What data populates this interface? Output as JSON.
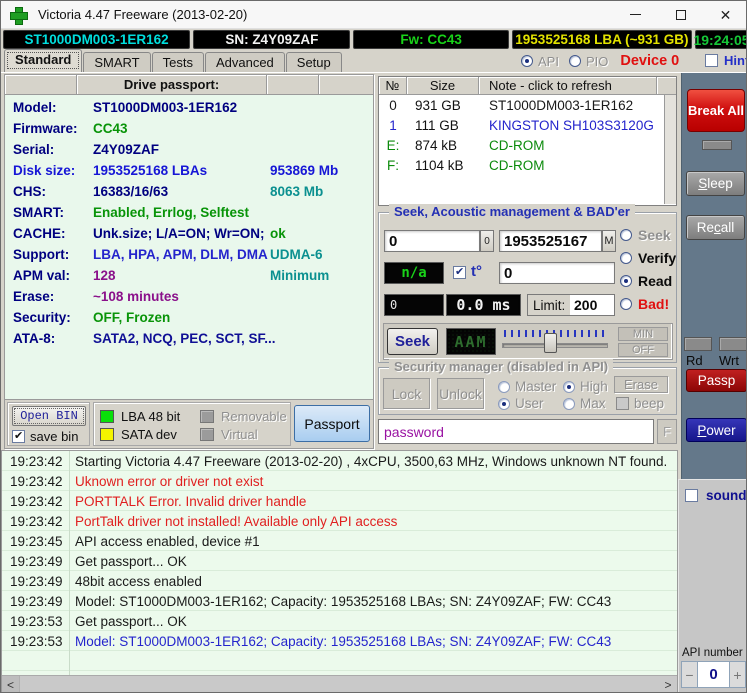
{
  "window": {
    "title": "Victoria 4.47  Freeware (2013-02-20)",
    "icons": {
      "app": "green-cross",
      "minimize": "minimize-line",
      "maximize": "maximize-square",
      "close": "✕",
      "scroll_left": "<",
      "scroll_right": ">",
      "spinner_minus": "−",
      "spinner_plus": "+"
    }
  },
  "info_bar": {
    "model": "ST1000DM003-1ER162",
    "serial": "SN: Z4Y09ZAF",
    "firmware": "Fw: CC43",
    "capacity": "1953525168 LBA (~931 GB)",
    "clock": "19:24:05",
    "colors": {
      "model": "#00dede",
      "serial": "#f2f2f2",
      "firmware": "#19d219",
      "capacity": "#e3e300",
      "clock": "#16c838"
    }
  },
  "tab_bar": {
    "tabs": [
      {
        "label": "Standard",
        "active": true
      },
      {
        "label": "SMART",
        "active": false
      },
      {
        "label": "Tests",
        "active": false
      },
      {
        "label": "Advanced",
        "active": false
      },
      {
        "label": "Setup",
        "active": false
      }
    ],
    "api_label": "API",
    "pio_label": "PIO",
    "device_label": "Device 0",
    "device_color": "#e01010",
    "hints_label": "Hints"
  },
  "passport": {
    "header": "Drive passport:",
    "rows": [
      {
        "label": "Model:",
        "value": "ST1000DM003-1ER162",
        "extra": "",
        "label_color": "#000080",
        "value_color": "#000080",
        "extra_color": "#000080"
      },
      {
        "label": "Firmware:",
        "value": "CC43",
        "extra": "",
        "label_color": "#000080",
        "value_color": "#089408",
        "extra_color": "#000080"
      },
      {
        "label": "Serial:",
        "value": "Z4Y09ZAF",
        "extra": "",
        "label_color": "#000080",
        "value_color": "#000080",
        "extra_color": "#000080"
      },
      {
        "label": "Disk size:",
        "value": "1953525168 LBAs",
        "extra": "953869 Mb",
        "label_color": "#1616d6",
        "value_color": "#1616d6",
        "extra_color": "#1616d6"
      },
      {
        "label": "CHS:",
        "value": "16383/16/63",
        "extra": "8063 Mb",
        "label_color": "#000080",
        "value_color": "#000080",
        "extra_color": "#0b9090"
      },
      {
        "label": "SMART:",
        "value": "Enabled, Errlog, Selftest",
        "extra": "",
        "label_color": "#000080",
        "value_color": "#089408",
        "extra_color": "#000080"
      },
      {
        "label": "CACHE:",
        "value": "Unk.size; L/A=ON; Wr=ON;",
        "extra": "ok",
        "label_color": "#000080",
        "value_color": "#000080",
        "extra_color": "#089408"
      },
      {
        "label": "Support:",
        "value": "LBA, HPA, APM, DLM, DMA",
        "extra": "UDMA-6",
        "label_color": "#000080",
        "value_color": "#2424cc",
        "extra_color": "#0b9090"
      },
      {
        "label": "APM val:",
        "value": "128",
        "extra": "Minimum",
        "label_color": "#000080",
        "value_color": "#8a108a",
        "extra_color": "#0b9090"
      },
      {
        "label": "Erase:",
        "value": "~108 minutes",
        "extra": "",
        "label_color": "#000080",
        "value_color": "#8a108a",
        "extra_color": "#000080"
      },
      {
        "label": "Security:",
        "value": "OFF, Frozen",
        "extra": "",
        "label_color": "#000080",
        "value_color": "#089408",
        "extra_color": "#000080"
      },
      {
        "label": "ATA-8:",
        "value": "SATA2, NCQ, PEC, SCT, SF...",
        "extra": "",
        "label_color": "#000080",
        "value_color": "#101095",
        "extra_color": "#000080"
      }
    ],
    "open_bin_button": "Open BIN",
    "save_bin_label": "save bin",
    "legend": [
      {
        "swatch": "#0ae00a",
        "label": "LBA 48 bit",
        "disabled": false
      },
      {
        "swatch": "#9b9b9b",
        "label": "Removable",
        "disabled": true
      },
      {
        "swatch": "#f4f400",
        "label": "SATA dev",
        "disabled": false
      },
      {
        "swatch": "#9b9b9b",
        "label": "Virtual",
        "disabled": true
      }
    ],
    "passport_button": "Passport"
  },
  "drive_table": {
    "headers": {
      "num": "№",
      "size": "Size",
      "note": "Note - click to refresh"
    },
    "rows": [
      {
        "num": "0",
        "size": "931 GB",
        "note": "ST1000DM003-1ER162",
        "color": "#1a1a1a"
      },
      {
        "num": "1",
        "size": "111 GB",
        "note": "KINGSTON SH103S3120G",
        "color": "#2424cc"
      },
      {
        "num": "E:",
        "size": "874 kB",
        "note": "CD-ROM",
        "color": "#0b8a0b"
      },
      {
        "num": "F:",
        "size": "1104 kB",
        "note": "CD-ROM",
        "color": "#0b8a0b"
      }
    ]
  },
  "seek_panel": {
    "title": "Seek, Acoustic management & BAD'er",
    "start_value": "0",
    "start_button": "0",
    "end_value": "1953525167",
    "end_button": "M",
    "radios": [
      {
        "label": "Seek",
        "selected": false,
        "disabled": true,
        "color": ""
      },
      {
        "label": "Verify",
        "selected": false,
        "disabled": false,
        "color": "#0a0a0a"
      },
      {
        "label": "Read",
        "selected": true,
        "disabled": false,
        "color": "#0a0a0a"
      },
      {
        "label": "Bad!",
        "selected": false,
        "disabled": false,
        "color": "#e01010"
      }
    ],
    "temp_display": "n/a",
    "temp_label": "t°",
    "temp_input": "0",
    "counter_display": "0",
    "ms_display": "0.0 ms",
    "limit_label": "Limit:",
    "limit_value": "200",
    "seek_button": "Seek",
    "aam_display": "AAM",
    "min_button": "MIN",
    "off_button": "OFF"
  },
  "security_panel": {
    "title": "Security manager (disabled in API)",
    "lock_button": "Lock",
    "unlock_button": "Unlock",
    "master_label": "Master",
    "user_label": "User",
    "high_label": "High",
    "max_label": "Max",
    "erase_button": "Erase",
    "beep_label": "beep",
    "password_value": "password",
    "f_button": "F"
  },
  "sidebar": {
    "break_all": "Break All",
    "sleep": {
      "prefix": "",
      "accel": "S",
      "suffix": "leep"
    },
    "recall": {
      "prefix": "Re",
      "accel": "c",
      "suffix": "all"
    },
    "rd_label": "Rd",
    "wrt_label": "Wrt",
    "passp": "Passp",
    "power": {
      "prefix": "",
      "accel": "P",
      "suffix": "ower"
    }
  },
  "log": {
    "rows": [
      {
        "time": "19:23:42",
        "msg": "Starting Victoria 4.47  Freeware (2013-02-20) , 4xCPU, 3500,63 MHz, Windows unknown NT found.",
        "color": "#1a1a1a"
      },
      {
        "time": "19:23:42",
        "msg": "Uknown error or driver not exist",
        "color": "#e02020"
      },
      {
        "time": "19:23:42",
        "msg": "PORTTALK Error. Invalid driver handle",
        "color": "#e02020"
      },
      {
        "time": "19:23:42",
        "msg": "PortTalk driver not installed! Available only API access",
        "color": "#e02020"
      },
      {
        "time": "19:23:45",
        "msg": "API access enabled, device #1",
        "color": "#1a1a1a"
      },
      {
        "time": "19:23:49",
        "msg": "Get passport... OK",
        "color": "#1a1a1a"
      },
      {
        "time": "19:23:49",
        "msg": "48bit access enabled",
        "color": "#1a1a1a"
      },
      {
        "time": "19:23:49",
        "msg": "Model: ST1000DM003-1ER162; Capacity: 1953525168 LBAs; SN: Z4Y09ZAF; FW: CC43",
        "color": "#1a1a1a"
      },
      {
        "time": "19:23:53",
        "msg": "Get passport... OK",
        "color": "#1a1a1a"
      },
      {
        "time": "19:23:53",
        "msg": "Model: ST1000DM003-1ER162; Capacity: 1953525168 LBAs; SN: Z4Y09ZAF; FW: CC43",
        "color": "#2424cc"
      }
    ]
  },
  "bottom_right": {
    "sound_label": "sound",
    "api_number_label": "API number",
    "api_number_value": "0"
  }
}
